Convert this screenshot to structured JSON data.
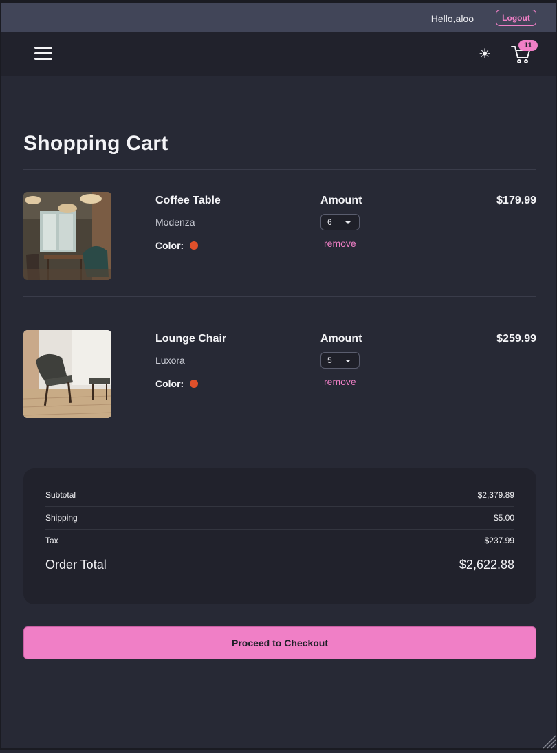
{
  "header": {
    "greeting": "Hello,aloo",
    "logout_label": "Logout"
  },
  "navbar": {
    "menu_icon": "hamburger-menu-icon",
    "theme_icon": "sun-icon",
    "theme_glyph": "☀",
    "cart_icon": "shopping-cart-icon",
    "cart_count": "11"
  },
  "page": {
    "title": "Shopping Cart"
  },
  "cart": {
    "items": [
      {
        "name": "Coffee Table",
        "brand": "Modenza",
        "color_label": "Color:",
        "color": "#e0502b",
        "amount_label": "Amount",
        "amount": "6",
        "remove_label": "remove",
        "price": "$179.99"
      },
      {
        "name": "Lounge Chair",
        "brand": "Luxora",
        "color_label": "Color:",
        "color": "#e0502b",
        "amount_label": "Amount",
        "amount": "5",
        "remove_label": "remove",
        "price": "$259.99"
      }
    ]
  },
  "summary": {
    "subtotal_label": "Subtotal",
    "subtotal": "$2,379.89",
    "shipping_label": "Shipping",
    "shipping": "$5.00",
    "tax_label": "Tax",
    "tax": "$237.99",
    "total_label": "Order Total",
    "total": "$2,622.88"
  },
  "checkout_label": "Proceed to Checkout",
  "colors": {
    "accent": "#f07fc6",
    "background": "#272935",
    "topbar": "#414558",
    "navbar": "#21222c"
  }
}
